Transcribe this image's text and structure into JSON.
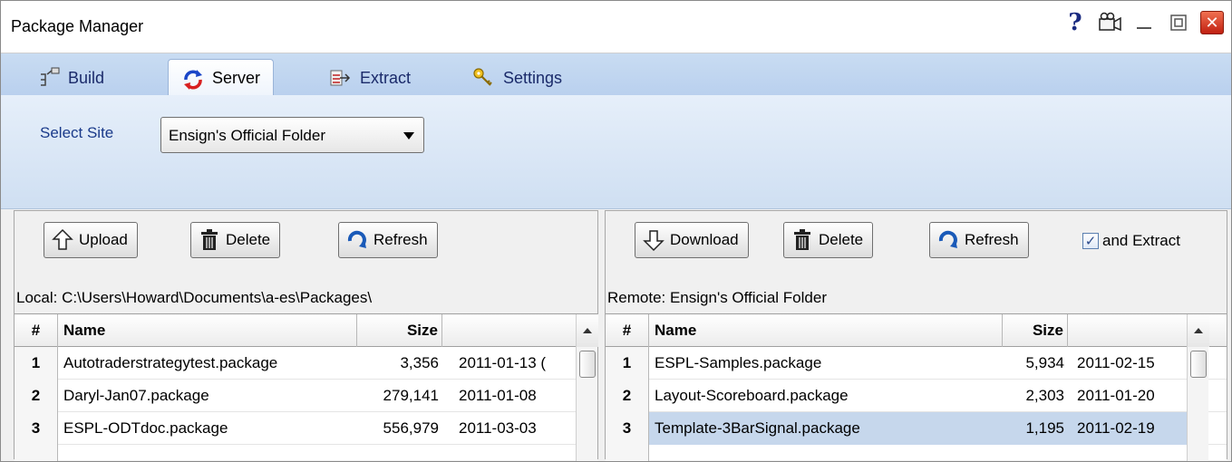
{
  "window": {
    "title": "Package Manager",
    "help_glyph": "?"
  },
  "tabs": [
    {
      "label": "Build",
      "icon": "build-icon",
      "active": false
    },
    {
      "label": "Server",
      "icon": "refresh-cycle-icon",
      "active": true
    },
    {
      "label": "Extract",
      "icon": "extract-icon",
      "active": false
    },
    {
      "label": "Settings",
      "icon": "keys-icon",
      "active": false
    }
  ],
  "server": {
    "select_site_label": "Select Site",
    "selected_site": "Ensign's Official Folder"
  },
  "local": {
    "buttons": {
      "upload": "Upload",
      "delete": "Delete",
      "refresh": "Refresh"
    },
    "path": "Local: C:\\Users\\Howard\\Documents\\a-es\\Packages\\",
    "columns": {
      "num": "#",
      "name": "Name",
      "size": "Size"
    },
    "rows": [
      {
        "num": "1",
        "name": "Autotraderstrategytest.package",
        "size": "3,356",
        "date": "2011-01-13 ("
      },
      {
        "num": "2",
        "name": "Daryl-Jan07.package",
        "size": "279,141",
        "date": "2011-01-08"
      },
      {
        "num": "3",
        "name": "ESPL-ODTdoc.package",
        "size": "556,979",
        "date": "2011-03-03"
      }
    ]
  },
  "remote": {
    "buttons": {
      "download": "Download",
      "delete": "Delete",
      "refresh": "Refresh"
    },
    "extract_checkbox": {
      "label": "and Extract",
      "checked": true,
      "glyph": "✓"
    },
    "path": "Remote: Ensign's Official Folder",
    "columns": {
      "num": "#",
      "name": "Name",
      "size": "Size"
    },
    "rows": [
      {
        "num": "1",
        "name": "ESPL-Samples.package",
        "size": "5,934",
        "date": "2011-02-15"
      },
      {
        "num": "2",
        "name": "Layout-Scoreboard.package",
        "size": "2,303",
        "date": "2011-01-20"
      },
      {
        "num": "3",
        "name": "Template-3BarSignal.package",
        "size": "1,195",
        "date": "2011-02-19",
        "selected": true
      }
    ]
  },
  "colors": {
    "tab_bg": "#c9dcf2",
    "selection": "#c6d7ec",
    "close_red": "#d03020"
  }
}
